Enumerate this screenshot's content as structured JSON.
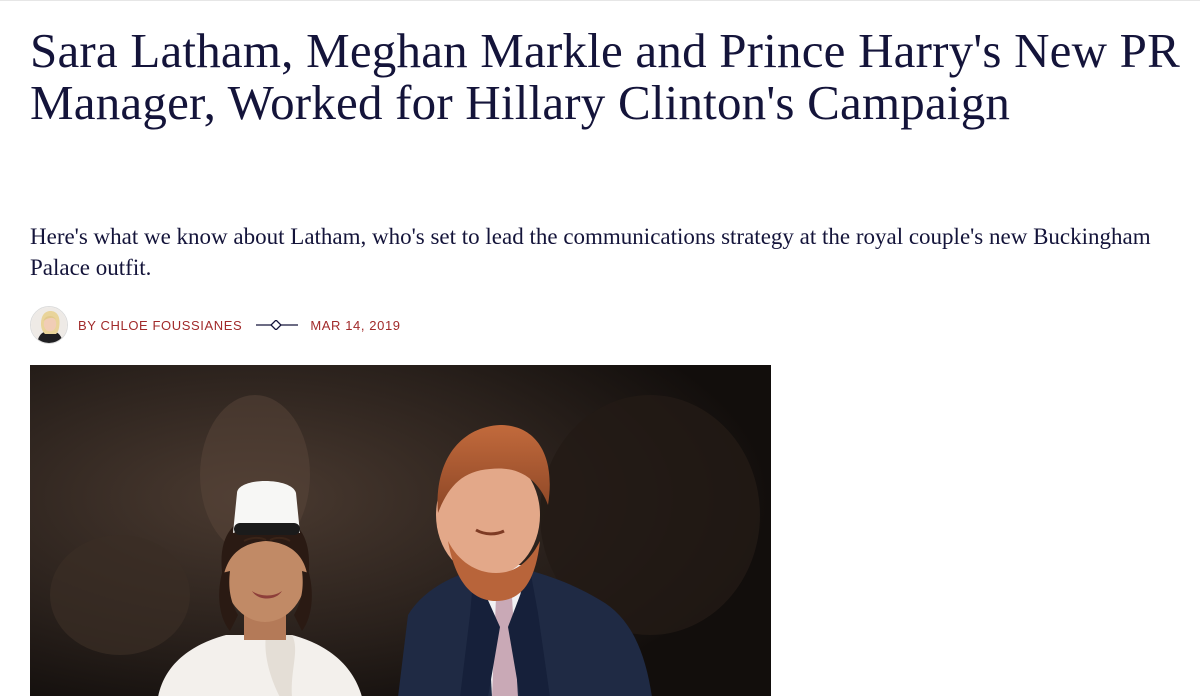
{
  "article": {
    "headline": "Sara Latham, Meghan Markle and Prince Harry's New PR Manager, Worked for Hillary Clinton's Campaign",
    "dek": "Here's what we know about Latham, who's set to lead the communications strategy at the royal couple's new Buckingham Palace outfit.",
    "byline": {
      "author": "BY CHLOE FOUSSIANES",
      "date": "MAR 14, 2019"
    }
  },
  "icons": {
    "byline_divider": "diamond-line-icon"
  },
  "colors": {
    "headline": "#14143a",
    "byline_accent": "#a12a2a"
  }
}
